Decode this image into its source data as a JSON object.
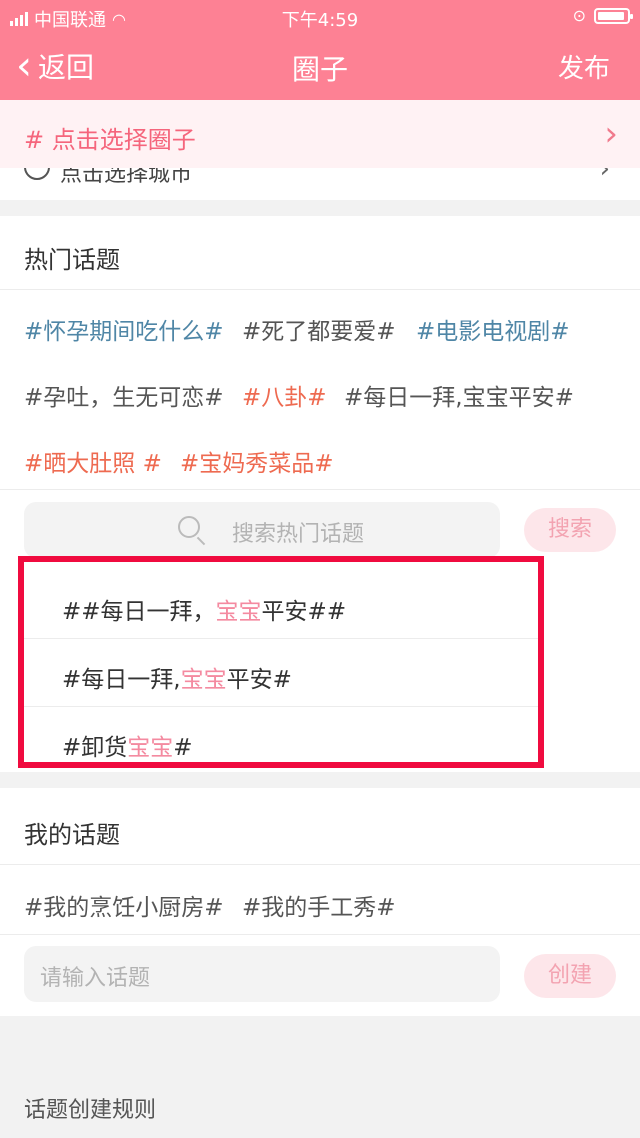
{
  "status": {
    "carrier": "中国联通",
    "time": "下午4:59"
  },
  "nav": {
    "back_label": "返回",
    "title": "圈子",
    "publish_label": "发布"
  },
  "circle_select": {
    "label": "# 点击选择圈子"
  },
  "location": {
    "label": "点击选择城市"
  },
  "hot_topics": {
    "title": "热门话题",
    "tags": [
      "#怀孕期间吃什么#",
      "#死了都要爱#",
      "#电影电视剧#",
      "#孕吐，生无可恋#",
      "#八卦#",
      "#每日一拜,宝宝平安#",
      "#晒大肚照 #",
      "#宝妈秀菜品#"
    ]
  },
  "search": {
    "placeholder": "搜索热门话题",
    "button_label": "搜索"
  },
  "search_results": [
    {
      "pre": "##每日一拜，",
      "hl": "宝宝",
      "post": "平安##"
    },
    {
      "pre": "#每日一拜,",
      "hl": "宝宝",
      "post": "平安#"
    },
    {
      "pre": "#卸货",
      "hl": "宝宝",
      "post": "#"
    }
  ],
  "my_topics": {
    "title": "我的话题",
    "tags": [
      "#我的烹饪小厨房#",
      "#我的手工秀#"
    ],
    "input_placeholder": "请输入话题",
    "create_label": "创建"
  },
  "rules_link": "话题创建规则",
  "colors": {
    "header": "#fd8194",
    "accent": "#f5657c",
    "highlight_frame": "#f00b3f",
    "tag_blue": "#4f86a6",
    "tag_red": "#ee6a50"
  }
}
